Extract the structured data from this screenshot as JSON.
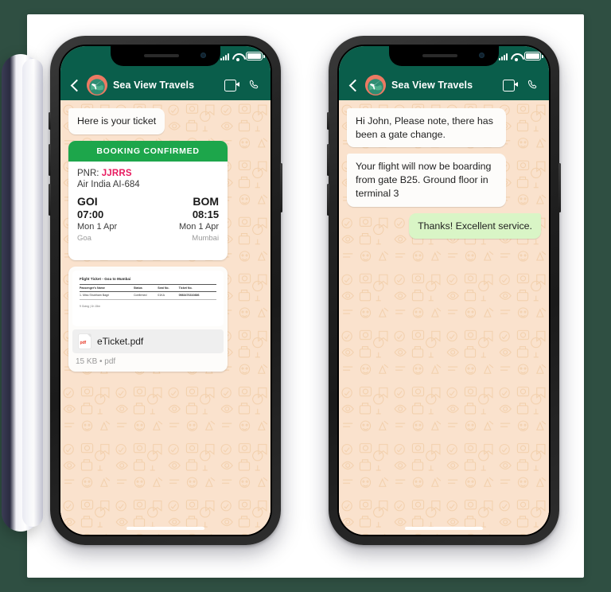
{
  "scene": {
    "background_color": "#2f4f42",
    "card_color": "#ffffff"
  },
  "theme": {
    "header_green": "#0a5e4b",
    "banner_green": "#1da64b",
    "outgoing_bubble": "#d9f5c6",
    "incoming_bubble": "#fdfcfa",
    "wallpaper": "#fae2cd",
    "pnr_accent": "#e8195e"
  },
  "phones": [
    {
      "id": "phone-left",
      "status_bar": {
        "signal_icon": "signal-bars-icon",
        "wifi_icon": "wifi-icon",
        "battery_icon": "battery-full-icon"
      },
      "header": {
        "back_icon": "back-arrow-icon",
        "avatar_icon": "globe-airplane-avatar",
        "contact_name": "Sea View Travels",
        "video_icon": "video-call-icon",
        "call_icon": "phone-call-icon"
      },
      "messages": [
        {
          "type": "text",
          "direction": "in",
          "text": "Here is your ticket"
        }
      ],
      "ticket": {
        "banner": "BOOKING CONFIRMED",
        "pnr_label": "PNR:",
        "pnr_value": "JJRRS",
        "airline": "Air India AI-684",
        "departure": {
          "code": "GOI",
          "time": "07:00",
          "date": "Mon 1 Apr",
          "city": "Goa"
        },
        "arrival": {
          "code": "BOM",
          "time": "08:15",
          "date": "Mon 1 Apr",
          "city": "Mumbai"
        }
      },
      "attachment": {
        "preview": {
          "title": "Flight Ticket - Goa to Mumbai",
          "columns": [
            "Passenger's Name",
            "Status",
            "Seat No.",
            "Ticket No."
          ],
          "rows": [
            [
              "1. Miss Shubham Bagri",
              "Confirmed",
              "01KA",
              "0983476310886"
            ]
          ],
          "footer": "9 Going | 1h 15m"
        },
        "file_icon": "pdf-file-icon",
        "file_name": "eTicket.pdf",
        "meta": "15 KB • pdf"
      }
    },
    {
      "id": "phone-right",
      "status_bar": {
        "signal_icon": "signal-bars-icon",
        "wifi_icon": "wifi-icon",
        "battery_icon": "battery-full-icon"
      },
      "header": {
        "back_icon": "back-arrow-icon",
        "avatar_icon": "globe-airplane-avatar",
        "contact_name": "Sea View Travels",
        "video_icon": "video-call-icon",
        "call_icon": "phone-call-icon"
      },
      "messages": [
        {
          "type": "text",
          "direction": "in",
          "text": "Hi John, Please note, there has been a gate change."
        },
        {
          "type": "text",
          "direction": "in",
          "text": "Your flight will now be boarding from gate B25. Ground floor in terminal 3"
        },
        {
          "type": "text",
          "direction": "out",
          "text": "Thanks! Excellent service."
        }
      ]
    }
  ]
}
